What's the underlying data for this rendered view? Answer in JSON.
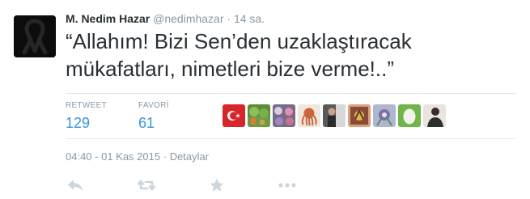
{
  "tweet": {
    "author_name": "M. Nedim Hazar",
    "author_handle": "@nedimhazar",
    "separator": "·",
    "relative_time": "14 sa.",
    "text": "“Allahım! Bizi Sen’den uzaklaştıracak mükafatları, nimetleri bize verme!..”",
    "retweet_label": "RETWEET",
    "retweet_count": "129",
    "favorite_label": "FAVORİ",
    "favorite_count": "61",
    "timestamp": "04:40 - 01 Kas 2015",
    "details_separator": "·",
    "details_label": "Detaylar"
  },
  "favoriters": [
    {
      "name": "turkish-flag-avatar"
    },
    {
      "name": "garden-avatar"
    },
    {
      "name": "colorful-avatar"
    },
    {
      "name": "octopus-avatar"
    },
    {
      "name": "person-avatar"
    },
    {
      "name": "bird-avatar"
    },
    {
      "name": "flower-avatar"
    },
    {
      "name": "egg-avatar"
    },
    {
      "name": "portrait-avatar"
    }
  ],
  "icons": {
    "reply": "reply-icon",
    "retweet": "retweet-icon",
    "favorite": "star-icon",
    "more": "more-icon"
  },
  "colors": {
    "accent": "#3b94d9",
    "text": "#292f33",
    "muted": "#8899a6",
    "icon": "#ccd6dd",
    "divider": "#e1e8ed"
  }
}
